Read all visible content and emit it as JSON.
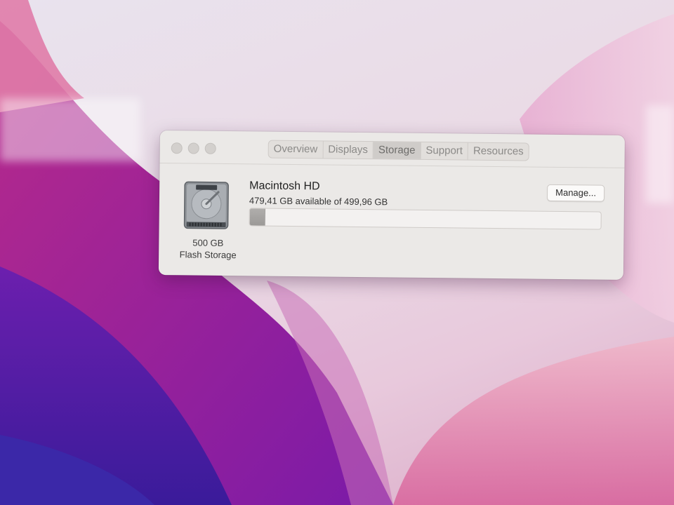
{
  "window": {
    "tabs": [
      {
        "label": "Overview",
        "active": false
      },
      {
        "label": "Displays",
        "active": false
      },
      {
        "label": "Storage",
        "active": true
      },
      {
        "label": "Support",
        "active": false
      },
      {
        "label": "Resources",
        "active": false
      }
    ]
  },
  "storage": {
    "disk_capacity": "500 GB",
    "disk_type": "Flash Storage",
    "volume_name": "Macintosh HD",
    "availability": "479,41 GB available of 499,96 GB",
    "manage_label": "Manage...",
    "used_fraction": 0.041
  },
  "colors": {
    "window_bg": "#ebe9e7",
    "active_tab": "#cfccc9",
    "usage_fill": "#a3a1a0"
  },
  "icons": {
    "disk": "hard-drive-icon"
  }
}
